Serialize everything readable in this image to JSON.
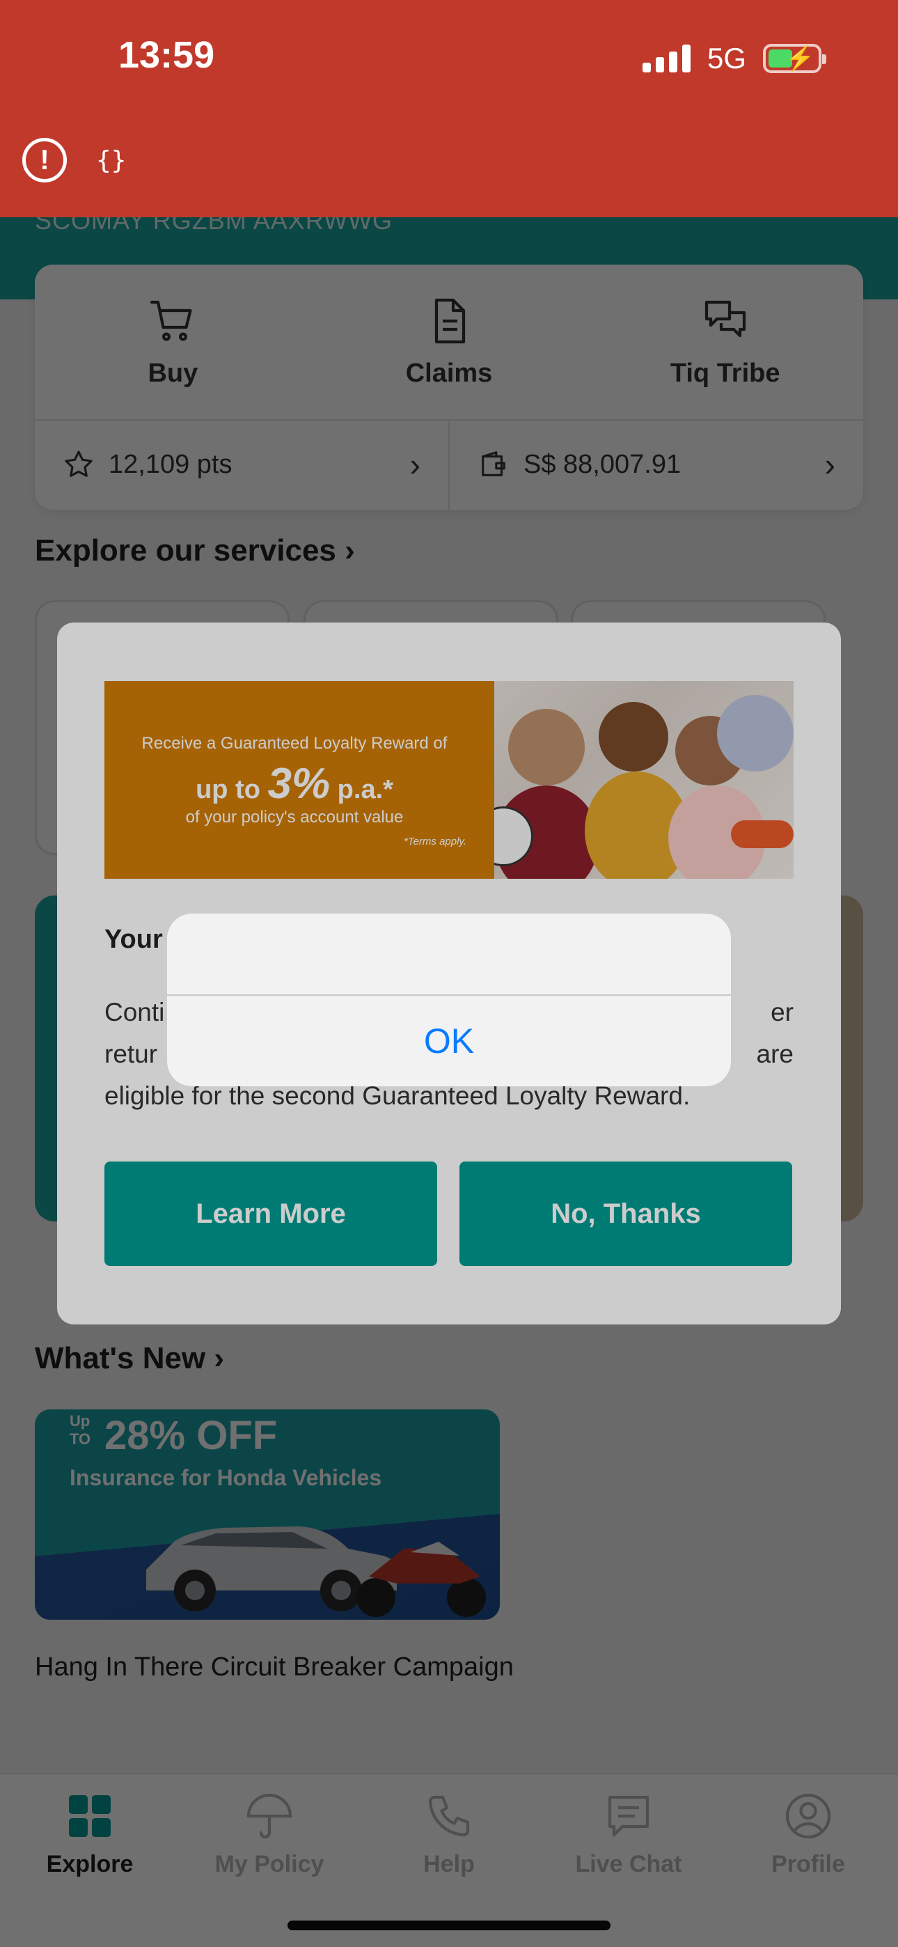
{
  "status_bar": {
    "time": "13:59",
    "network": "5G"
  },
  "header": {
    "customer_name": "SCOMAY RGZBM AAXRWWG"
  },
  "quick_actions": [
    {
      "label": "Buy",
      "icon": "cart-icon"
    },
    {
      "label": "Claims",
      "icon": "document-icon"
    },
    {
      "label": "Tiq Tribe",
      "icon": "chat-bubbles-icon"
    }
  ],
  "account": {
    "points": "12,109 pts",
    "wallet": "S$ 88,007.91"
  },
  "sections": {
    "explore": "Explore our services",
    "whats_new": "What's New"
  },
  "news": [
    {
      "title": "Hang In There Circuit Breaker Campaign",
      "image": {
        "up_to": "Up",
        "to": "TO",
        "discount": "28% OFF",
        "subtitle": "Insurance for Honda Vehicles"
      }
    }
  ],
  "modal": {
    "promo": {
      "line1": "Receive a Guaranteed Loyalty Reward of",
      "line2_prefix": "up to",
      "line2_big": "3%",
      "line2_suffix": "p.a.*",
      "line3": "of your policy's account value",
      "terms": "*Terms apply."
    },
    "title": "Your",
    "body_lines": [
      "Conti",
      "er",
      "retur",
      "are",
      "eligible for the second Guaranteed Loyalty Reward."
    ],
    "learn_more": "Learn More",
    "no_thanks": "No, Thanks"
  },
  "alert": {
    "ok": "OK"
  },
  "bottom_nav": [
    {
      "label": "Explore",
      "icon": "grid-icon",
      "active": true
    },
    {
      "label": "My Policy",
      "icon": "umbrella-icon",
      "active": false
    },
    {
      "label": "Help",
      "icon": "phone-icon",
      "active": false
    },
    {
      "label": "Live Chat",
      "icon": "message-icon",
      "active": false
    },
    {
      "label": "Profile",
      "icon": "person-icon",
      "active": false
    }
  ],
  "colors": {
    "status_bg": "#c0392b",
    "teal": "#1aa39b",
    "button_teal": "#009a92",
    "promo_orange": "#d07c08",
    "ios_blue": "#0a7aff"
  }
}
